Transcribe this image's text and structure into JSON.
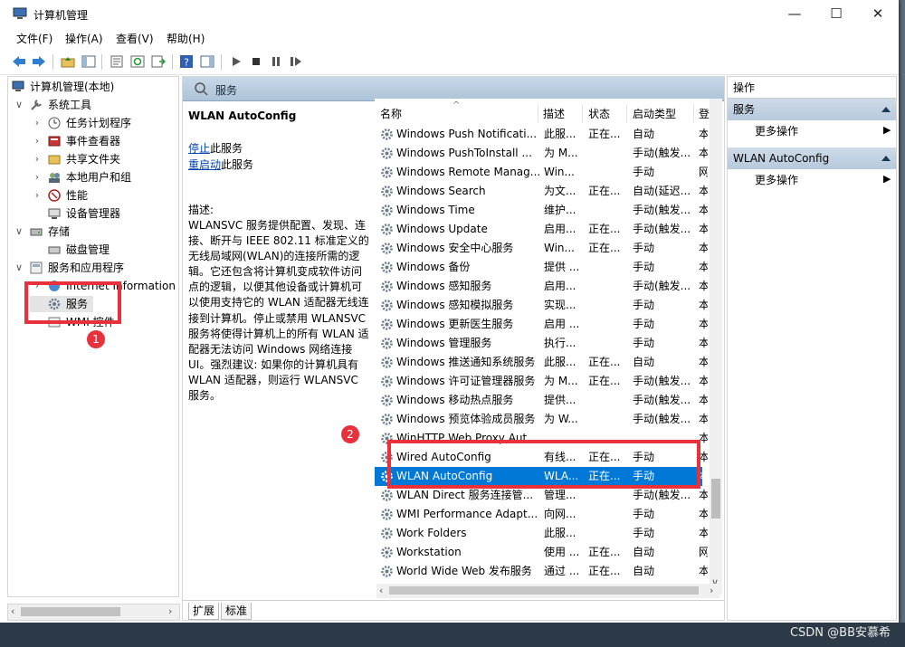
{
  "window": {
    "title": "计算机管理",
    "min": "—",
    "max": "☐",
    "close": "✕"
  },
  "menu": [
    "文件(F)",
    "操作(A)",
    "查看(V)",
    "帮助(H)"
  ],
  "tree": {
    "root": "计算机管理(本地)",
    "system_tools": "系统工具",
    "task_scheduler": "任务计划程序",
    "event_viewer": "事件查看器",
    "shared_folders": "共享文件夹",
    "local_users": "本地用户和组",
    "performance": "性能",
    "device_manager": "设备管理器",
    "storage": "存储",
    "disk_management": "磁盘管理",
    "services_apps": "服务和应用程序",
    "iis": "Internet Information S",
    "services": "服务",
    "wmi": "WMI 控件"
  },
  "center": {
    "header": "服务",
    "selected_service": "WLAN AutoConfig",
    "stop_link": "停止",
    "stop_rest": "此服务",
    "restart_link": "重启动",
    "restart_rest": "此服务",
    "desc_label": "描述:",
    "desc_text": "WLANSVC 服务提供配置、发现、连接、断开与 IEEE 802.11 标准定义的无线局域网(WLAN)的连接所需的逻辑。它还包含将计算机变成软件访问点的逻辑，以便其他设备或计算机可以使用支持它的 WLAN 适配器无线连接到计算机。停止或禁用 WLANSVC 服务将使得计算机上的所有 WLAN 适配器无法访问 Windows 网络连接 UI。强烈建议: 如果你的计算机具有 WLAN 适配器，则运行 WLANSVC 服务。",
    "columns": [
      "名称",
      "描述",
      "状态",
      "启动类型",
      "登"
    ],
    "rows": [
      [
        "Windows Push Notificati...",
        "此服...",
        "正在...",
        "自动",
        "本"
      ],
      [
        "Windows PushToInstall ...",
        "为 M...",
        "",
        "手动(触发...",
        "本"
      ],
      [
        "Windows Remote Manag...",
        "Win...",
        "",
        "手动",
        "网"
      ],
      [
        "Windows Search",
        "为文...",
        "正在...",
        "自动(延迟...",
        "本"
      ],
      [
        "Windows Time",
        "维护...",
        "",
        "手动(触发...",
        "本"
      ],
      [
        "Windows Update",
        "启用...",
        "正在...",
        "手动(触发...",
        "本"
      ],
      [
        "Windows 安全中心服务",
        "Win...",
        "正在...",
        "手动",
        "本"
      ],
      [
        "Windows 备份",
        "提供 ...",
        "",
        "手动",
        "本"
      ],
      [
        "Windows 感知服务",
        "启用...",
        "",
        "手动(触发...",
        "本"
      ],
      [
        "Windows 感知模拟服务",
        "实现...",
        "",
        "手动",
        "本"
      ],
      [
        "Windows 更新医生服务",
        "启用 ...",
        "",
        "手动",
        "本"
      ],
      [
        "Windows 管理服务",
        "执行...",
        "",
        "手动",
        "本"
      ],
      [
        "Windows 推送通知系统服务",
        "此服...",
        "正在...",
        "自动",
        "本"
      ],
      [
        "Windows 许可证管理器服务",
        "为 M...",
        "正在...",
        "手动(触发...",
        "本"
      ],
      [
        "Windows 移动热点服务",
        "提供...",
        "",
        "手动(触发...",
        "本"
      ],
      [
        "Windows 预览体验成员服务",
        "为 W...",
        "",
        "手动(触发...",
        "本"
      ],
      [
        "WinHTTP Web Proxy Aut...",
        "",
        "",
        "",
        "本"
      ],
      [
        "Wired AutoConfig",
        "有线...",
        "正在...",
        "手动",
        "本"
      ],
      [
        "WLAN AutoConfig",
        "WLA...",
        "正在...",
        "手动",
        "本"
      ],
      [
        "WLAN Direct 服务连接管...",
        "管理...",
        "",
        "手动(触发...",
        "本"
      ],
      [
        "WMI Performance Adapt...",
        "向网...",
        "",
        "手动",
        "本"
      ],
      [
        "Work Folders",
        "此服...",
        "",
        "手动",
        "本"
      ],
      [
        "Workstation",
        "使用 ...",
        "正在...",
        "自动",
        "网"
      ],
      [
        "World Wide Web 发布服务",
        "通过 ...",
        "正在...",
        "自动",
        "本"
      ]
    ],
    "selected_index": 18,
    "tabs": [
      "扩展",
      "标准"
    ]
  },
  "actions": {
    "title": "操作",
    "section1": "服务",
    "more1": "更多操作",
    "section2": "WLAN AutoConfig",
    "more2": "更多操作"
  },
  "annotations": {
    "badge1": "1",
    "badge2": "2"
  },
  "watermark": "CSDN @BB安慕希",
  "colors": {
    "selection": "#0078d7",
    "annotation": "#e8313a",
    "header_blue": "#adc3d8"
  }
}
